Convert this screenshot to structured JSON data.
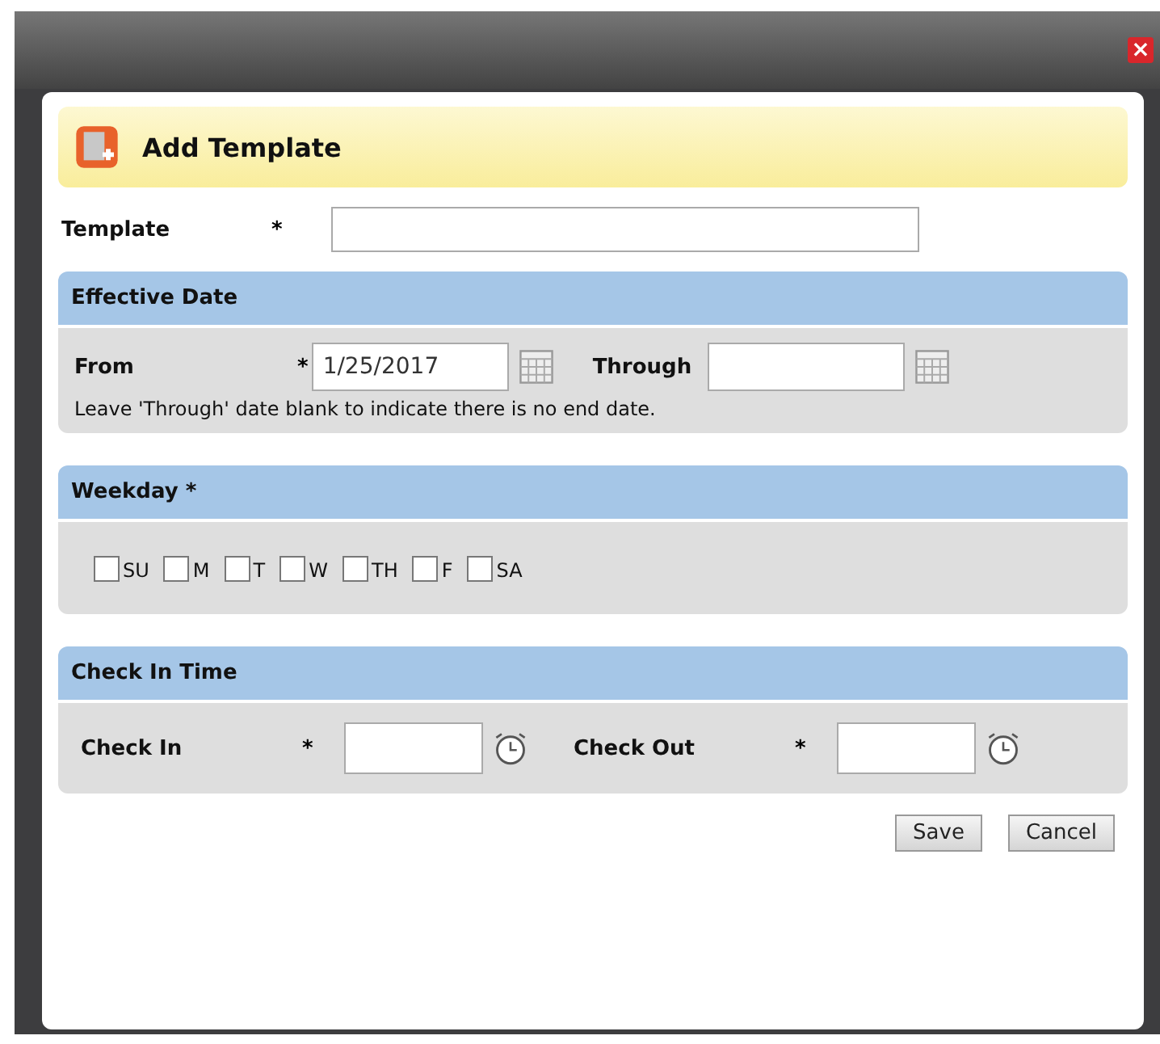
{
  "window": {
    "close_label": "×"
  },
  "header": {
    "title": "Add Template"
  },
  "template": {
    "label": "Template",
    "marker": "*"
  },
  "effective_date": {
    "title": "Effective Date",
    "from_label": "From",
    "from_marker": "*",
    "from_value": "1/25/2017",
    "through_label": "Through",
    "note": "Leave 'Through' date blank to indicate there is no end date."
  },
  "weekday": {
    "title": "Weekday *",
    "days": [
      {
        "label": "SU",
        "checked": false
      },
      {
        "label": "M",
        "checked": false
      },
      {
        "label": "T",
        "checked": false
      },
      {
        "label": "W",
        "checked": false
      },
      {
        "label": "TH",
        "checked": false
      },
      {
        "label": "F",
        "checked": false
      },
      {
        "label": "SA",
        "checked": false
      }
    ]
  },
  "check_in_time": {
    "title": "Check In Time",
    "fields": [
      {
        "label": "Check In",
        "marker": "*"
      },
      {
        "label": "Check Out",
        "marker": "*"
      }
    ]
  },
  "buttons": [
    "Save",
    "Cancel"
  ]
}
